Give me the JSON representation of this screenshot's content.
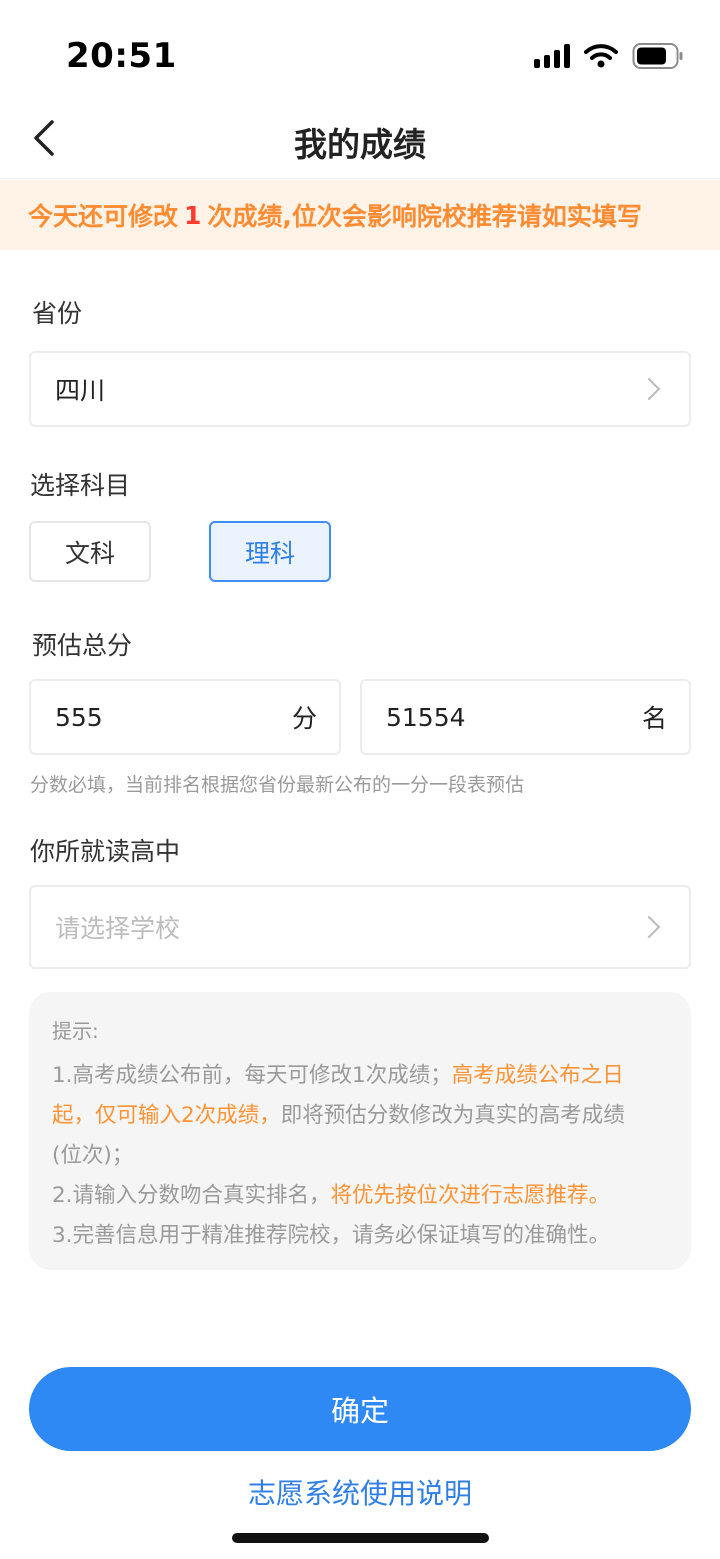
{
  "status_bar": {
    "time": "20:51"
  },
  "nav": {
    "title": "我的成绩"
  },
  "notice": {
    "prefix": "今天还可修改",
    "count": "1",
    "suffix": "次成绩,位次会影响院校推荐请如实填写"
  },
  "province": {
    "label": "省份",
    "value": "四川"
  },
  "subject": {
    "label": "选择科目",
    "options": [
      "文科",
      "理科"
    ],
    "selected": "理科"
  },
  "score": {
    "label": "预估总分",
    "value": "555",
    "unit": "分",
    "rank": "51554",
    "rank_unit": "名",
    "hint": "分数必填，当前排名根据您省份最新公布的一分一段表预估"
  },
  "school": {
    "label": "你所就读高中",
    "placeholder": "请选择学校"
  },
  "tips": {
    "title": "提示:",
    "line1_a": "1.高考成绩公布前，每天可修改1次成绩；",
    "line1_b": "高考成绩公布之日",
    "line2_b": "起，仅可输入2次成绩，",
    "line2_c": "即将预估分数修改为真实的高考成绩",
    "line3": "(位次)；",
    "line4_a": "2.请输入分数吻合真实排名，",
    "line4_b": "将优先按位次进行志愿推荐。",
    "line5": "3.完善信息用于精准推荐院校，请务必保证填写的准确性。"
  },
  "actions": {
    "confirm": "确定",
    "help": "志愿系统使用说明"
  },
  "colors": {
    "accent": "#2f89f5",
    "warning": "#ff8c33",
    "count": "#ff3b30"
  }
}
